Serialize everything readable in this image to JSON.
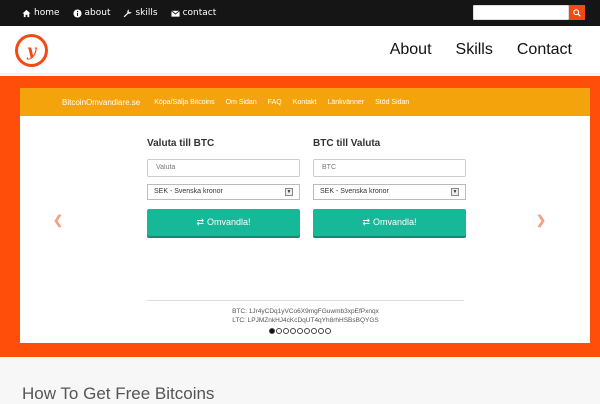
{
  "topnav": [
    {
      "label": "home",
      "icon": "home-icon"
    },
    {
      "label": "about",
      "icon": "info-icon"
    },
    {
      "label": "skills",
      "icon": "wrench-icon"
    },
    {
      "label": "contact",
      "icon": "envelope-icon"
    }
  ],
  "search": {
    "placeholder": "",
    "button_icon": "search-icon"
  },
  "logo": {
    "letter": "y"
  },
  "mainnav": [
    "About",
    "Skills",
    "Contact"
  ],
  "card": {
    "nav": {
      "brand": "BitcoinOmvandlare.se",
      "items": [
        "Köpa/Sälja Bitcoins",
        "Om Sidan",
        "FAQ",
        "Kontakt",
        "Länkvänner",
        "Stöd Sidan"
      ]
    },
    "left": {
      "title": "Valuta till BTC",
      "input_placeholder": "Valuta",
      "select": "SEK - Svenska kronor",
      "button": "Omvandla!"
    },
    "right": {
      "title": "BTC till Valuta",
      "input_placeholder": "BTC",
      "select": "SEK - Svenska kronor",
      "button": "Omvandla!"
    },
    "btc_address": "BTC: 1Jr4yCDq1yVCo6X9mgFGuwmb3xpEfPxnqx",
    "ltc_address": "LTC: LPJMZnkHJ4cKcDqUT4qYh8rhHSBsBQYGS",
    "carousel": {
      "count": 9,
      "active": 0
    }
  },
  "section_title": "How To Get Free Bitcoins",
  "colors": {
    "accent": "#ff4d0a",
    "nav_orange": "#f5a30c",
    "button": "#17b897"
  }
}
